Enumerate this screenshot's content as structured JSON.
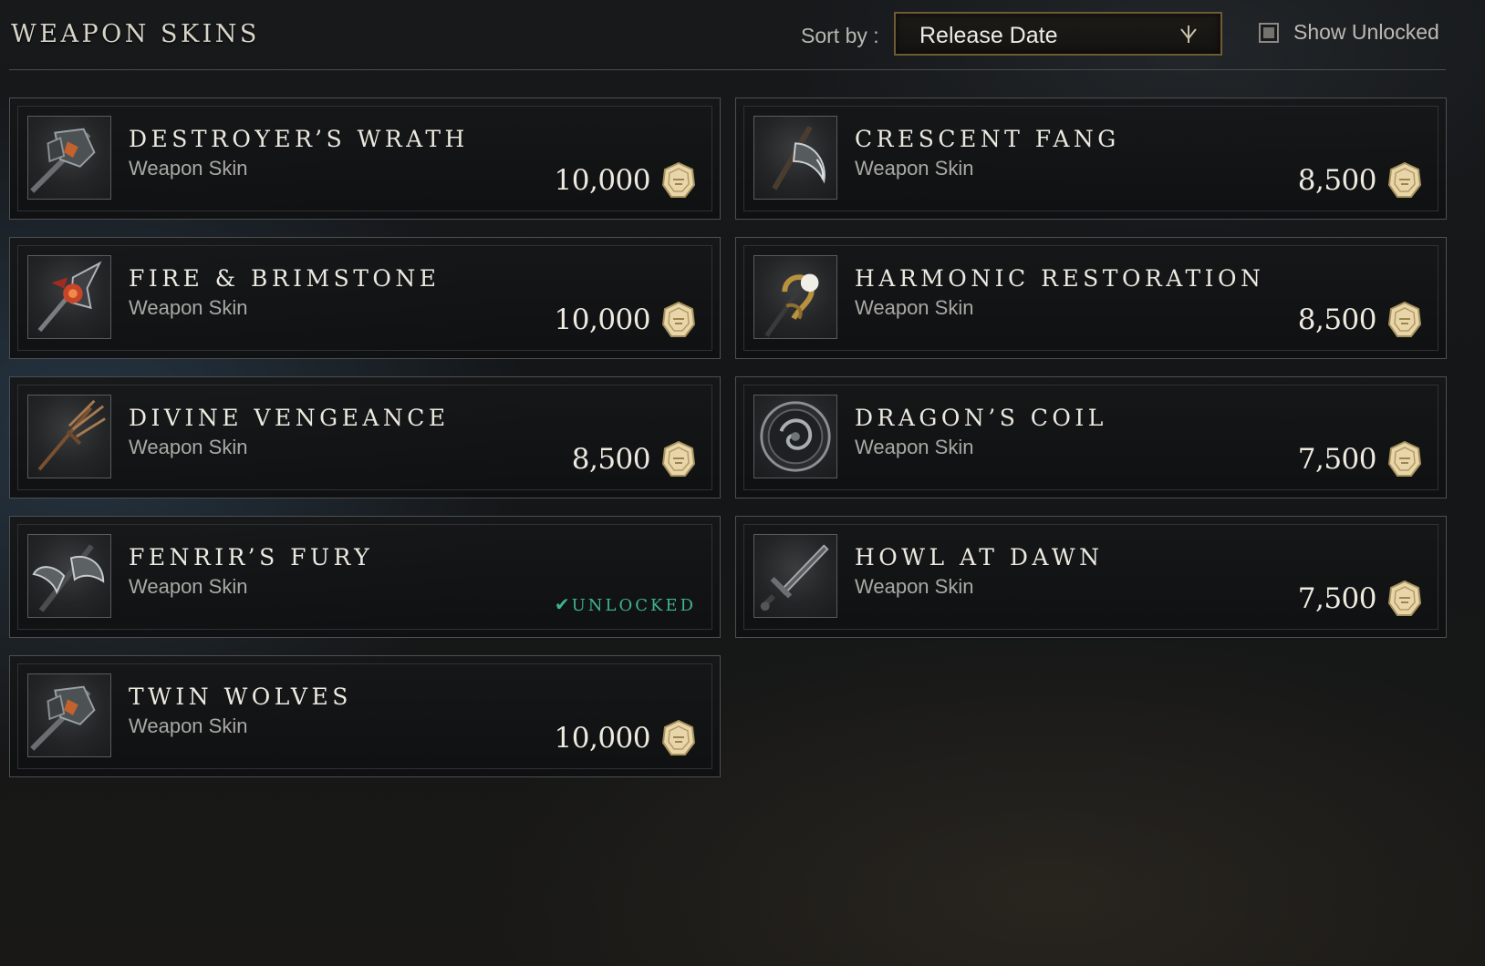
{
  "header": {
    "title": "WEAPON SKINS",
    "sort_label": "Sort by :",
    "sort_value": "Release Date",
    "sort_arrow_icon": "chevron-down-icon",
    "show_unlocked_label": "Show Unlocked",
    "show_unlocked_checked": false
  },
  "items": [
    {
      "name": "DESTROYER’S WRATH",
      "type": "Weapon Skin",
      "price": "10,000",
      "unlocked": false,
      "icon": "war-hammer-icon"
    },
    {
      "name": "CRESCENT FANG",
      "type": "Weapon Skin",
      "price": "8,500",
      "unlocked": false,
      "icon": "hatchet-icon"
    },
    {
      "name": "FIRE & BRIMSTONE",
      "type": "Weapon Skin",
      "price": "10,000",
      "unlocked": false,
      "icon": "fire-staff-icon"
    },
    {
      "name": "HARMONIC RESTORATION",
      "type": "Weapon Skin",
      "price": "8,500",
      "unlocked": false,
      "icon": "life-staff-icon"
    },
    {
      "name": "DIVINE VENGEANCE",
      "type": "Weapon Skin",
      "price": "8,500",
      "unlocked": false,
      "icon": "spear-icon"
    },
    {
      "name": "DRAGON’S COIL",
      "type": "Weapon Skin",
      "price": "7,500",
      "unlocked": false,
      "icon": "shield-icon"
    },
    {
      "name": "FENRIR’S FURY",
      "type": "Weapon Skin",
      "price": "",
      "unlocked": true,
      "unlocked_label": "UNLOCKED",
      "icon": "great-axe-icon"
    },
    {
      "name": "HOWL AT DAWN",
      "type": "Weapon Skin",
      "price": "7,500",
      "unlocked": false,
      "icon": "sword-icon"
    },
    {
      "name": "TWIN WOLVES",
      "type": "Weapon Skin",
      "price": "10,000",
      "unlocked": false,
      "icon": "war-hammer-icon"
    }
  ],
  "currency_icon": "coin-icon",
  "colors": {
    "unlocked_accent": "#3fb58a",
    "dropdown_border": "#6e5a33",
    "coin": "#e6d2a2"
  }
}
